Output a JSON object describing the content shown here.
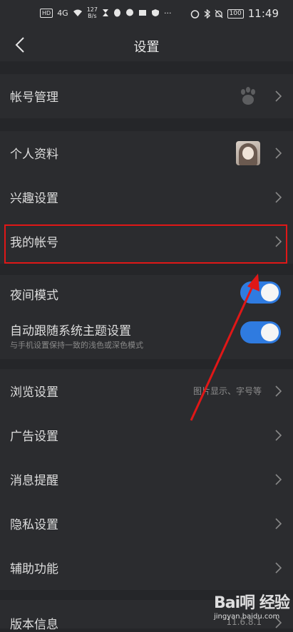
{
  "status_bar": {
    "badge_hd": "HD",
    "signal": "4G",
    "speed_value": "127",
    "speed_unit": "B/s",
    "more": "···",
    "battery": "100",
    "time": "11:49"
  },
  "header": {
    "title": "设置"
  },
  "rows": {
    "account_mgmt": "帐号管理",
    "profile": "个人资料",
    "interest": "兴趣设置",
    "my_account": "我的帐号",
    "night_mode": "夜间模式",
    "auto_theme": "自动跟随系统主题设置",
    "auto_theme_sub": "与手机设置保持一致的浅色或深色模式",
    "browse": "浏览设置",
    "browse_hint": "图片显示、字号等",
    "ads": "广告设置",
    "notifications": "消息提醒",
    "privacy": "隐私设置",
    "accessibility": "辅助功能",
    "version": "版本信息",
    "version_value": "11.6.8.1"
  },
  "toggles": {
    "night_mode_on": true,
    "auto_theme_on": true
  },
  "watermark": {
    "logo": "Bai哃 经验",
    "url": "jingyan.baidu.com"
  },
  "colors": {
    "background": "#252629",
    "row": "#2b2c2f",
    "toggle_on": "#2f7be0",
    "highlight": "#e01717"
  }
}
